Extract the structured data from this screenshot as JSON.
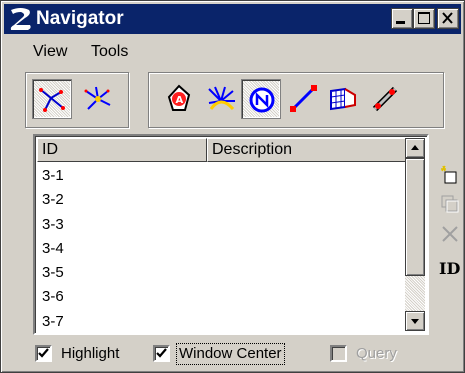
{
  "window": {
    "title": "Navigator"
  },
  "titlebar_buttons": [
    "minimize-icon",
    "maximize-icon",
    "close-icon"
  ],
  "menu": {
    "items": [
      {
        "label": "View"
      },
      {
        "label": "Tools"
      }
    ]
  },
  "toolbar": {
    "group1": [
      {
        "icon": "network-view-icon",
        "pressed": true
      },
      {
        "icon": "node-star-icon",
        "pressed": false
      }
    ],
    "group2": [
      {
        "icon": "alignment-a-icon",
        "pressed": false
      },
      {
        "icon": "burst-icon",
        "pressed": false
      },
      {
        "icon": "navigation-n-icon",
        "pressed": true
      },
      {
        "icon": "line-segment-icon",
        "pressed": false
      },
      {
        "icon": "flag-grid-icon",
        "pressed": false
      },
      {
        "icon": "diagonal-tool-icon",
        "pressed": false
      }
    ]
  },
  "list": {
    "columns": [
      "ID",
      "Description"
    ],
    "rows": [
      {
        "id": "3-1",
        "description": ""
      },
      {
        "id": "3-2",
        "description": ""
      },
      {
        "id": "3-3",
        "description": ""
      },
      {
        "id": "3-4",
        "description": ""
      },
      {
        "id": "3-5",
        "description": ""
      },
      {
        "id": "3-6",
        "description": ""
      },
      {
        "id": "3-7",
        "description": ""
      }
    ]
  },
  "side_tools": [
    {
      "icon": "new-item-icon",
      "label": ""
    },
    {
      "icon": "copy-icon",
      "label": ""
    },
    {
      "icon": "delete-icon",
      "label": ""
    },
    {
      "icon": "id-icon",
      "label": "ID"
    }
  ],
  "options": [
    {
      "label": "Highlight",
      "checked": true,
      "enabled": true
    },
    {
      "label": "Window Center",
      "checked": true,
      "enabled": true
    },
    {
      "label": "Query",
      "checked": false,
      "enabled": false
    }
  ],
  "colors": {
    "titlebar": "#0a246a",
    "face": "#d4d0c8",
    "accent": "#0000ff"
  }
}
